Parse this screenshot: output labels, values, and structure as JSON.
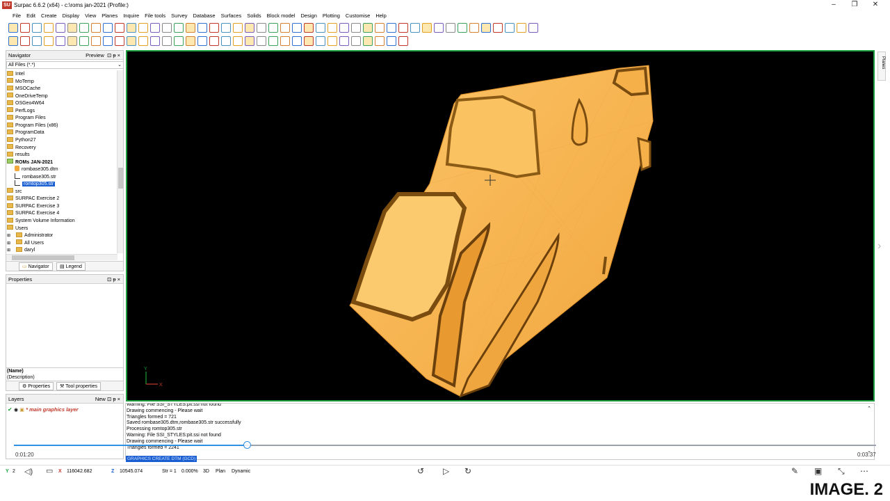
{
  "window": {
    "title": "Surpac 6.6.2 (x64) - c:\\roms jan-2021 (Profile:)",
    "logo": "SU",
    "controls": [
      "–",
      "❐",
      "✕"
    ]
  },
  "menu": [
    "File",
    "Edit",
    "Create",
    "Display",
    "View",
    "Planes",
    "Inquire",
    "File tools",
    "Survey",
    "Database",
    "Surfaces",
    "Solids",
    "Block model",
    "Design",
    "Plotting",
    "Customise",
    "Help"
  ],
  "navigator": {
    "title": "Navigator",
    "preview_label": "Preview",
    "filter": "All Files (*.*)",
    "items": [
      {
        "label": "Intel",
        "type": "folder"
      },
      {
        "label": "MoTemp",
        "type": "folder"
      },
      {
        "label": "MSOCache",
        "type": "folder"
      },
      {
        "label": "OneDriveTemp",
        "type": "folder"
      },
      {
        "label": "OSGeo4W64",
        "type": "folder"
      },
      {
        "label": "PerfLogs",
        "type": "folder"
      },
      {
        "label": "Program Files",
        "type": "folder"
      },
      {
        "label": "Program Files (x86)",
        "type": "folder"
      },
      {
        "label": "ProgramData",
        "type": "folder"
      },
      {
        "label": "Python27",
        "type": "folder"
      },
      {
        "label": "Recovery",
        "type": "folder"
      },
      {
        "label": "results",
        "type": "folder"
      },
      {
        "label": "ROMs JAN-2021",
        "type": "folder-open"
      },
      {
        "label": "rombase305.dtm",
        "type": "dtm"
      },
      {
        "label": "rombase305.str",
        "type": "str"
      },
      {
        "label": "romtop305.str",
        "type": "str-selected"
      },
      {
        "label": "src",
        "type": "folder"
      },
      {
        "label": "SURPAC Exercise 2",
        "type": "folder"
      },
      {
        "label": "SURPAC Exercise 3",
        "type": "folder"
      },
      {
        "label": "SURPAC Exercise 4",
        "type": "folder"
      },
      {
        "label": "System Volume Information",
        "type": "folder"
      },
      {
        "label": "Users",
        "type": "folder"
      },
      {
        "label": "Administrator",
        "type": "subfolder"
      },
      {
        "label": "All Users",
        "type": "subfolder"
      },
      {
        "label": "daryl",
        "type": "subfolder"
      }
    ],
    "tabs": [
      "Navigator",
      "Legend"
    ]
  },
  "properties": {
    "title": "Properties",
    "name": "(Name)",
    "description": "(Description)",
    "tabs": [
      "Properties",
      "Tool properties"
    ]
  },
  "layers": {
    "title": "Layers",
    "new_label": "New",
    "layer": "* main graphics layer"
  },
  "console": {
    "lines": [
      "Warning: File SSI_STYLES:pit.ssi not found",
      "Drawing commencing - Please wait",
      "Triangles formed = 721",
      "Saved rombase305.dtm,rombase305.str successfully",
      "Processing romtop305.str",
      "Warning: File SSI_STYLES:pit.ssi not found",
      "Drawing commencing - Please wait",
      "Triangles formed = 2241"
    ],
    "command": "GRAPHICS CREATE DTM (GCD)"
  },
  "video": {
    "current_time": "0:01:20",
    "total_time": "0:03:37",
    "progress": 0.27
  },
  "status": {
    "y_value": "2",
    "x_value": "116042.682",
    "z_value": "10545.074",
    "str_label": "Str = 1",
    "percent": "0.000%",
    "mode_3d": "3D",
    "plan": "Plan",
    "dynamic": "Dynamic"
  },
  "axes": {
    "y": "Y",
    "x": "X"
  },
  "side_tab": "Planes",
  "image_tag": "IMAGE. 2",
  "colors": {
    "viewport_border": "#1e9e3f",
    "selection": "#1a5fd1",
    "surface": "#f7b955"
  }
}
